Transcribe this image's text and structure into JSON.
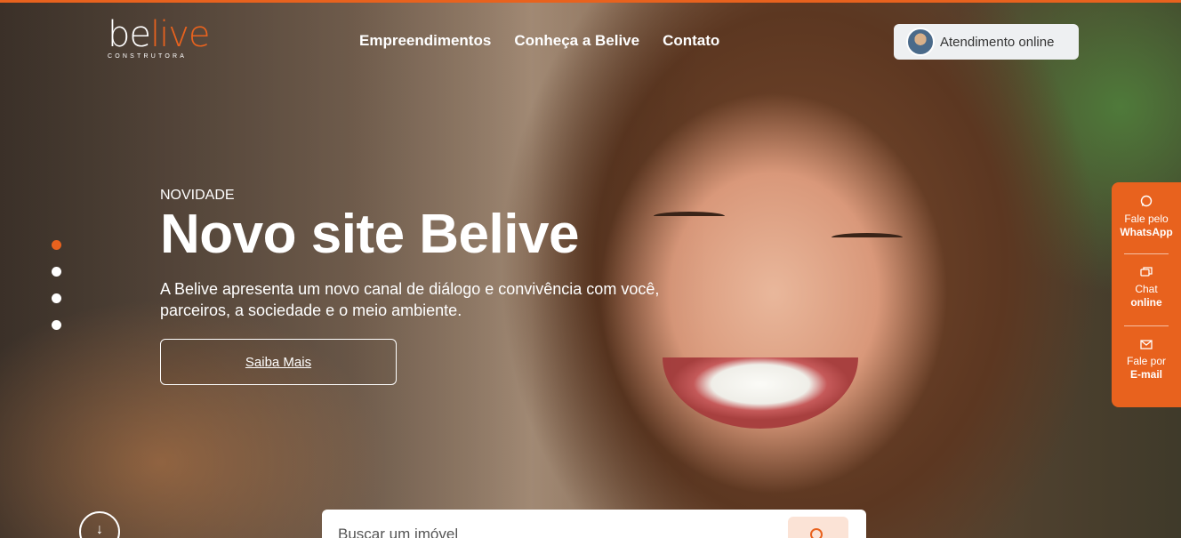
{
  "logo": {
    "be": "be",
    "live": "live",
    "sub": "CONSTRUTORA"
  },
  "nav": {
    "items": [
      "Empreendimentos",
      "Conheça a Belive",
      "Contato"
    ],
    "attend_label": "Atendimento online"
  },
  "hero": {
    "kicker": "NOVIDADE",
    "title": "Novo site Belive",
    "description": "A Belive apresenta um novo canal de diálogo e convivência com você, parceiros, a sociedade e o meio ambiente.",
    "cta": "Saiba Mais",
    "slides": {
      "count": 4,
      "active": 0
    }
  },
  "side": {
    "whatsapp": {
      "icon": "whatsapp-icon",
      "line1": "Fale pelo",
      "line2": "WhatsApp"
    },
    "chat": {
      "icon": "chat-icon",
      "line1": "Chat",
      "line2": "online"
    },
    "email": {
      "icon": "mail-icon",
      "line1": "Fale por",
      "line2": "E-mail"
    }
  },
  "search": {
    "placeholder": "Buscar um imóvel"
  },
  "colors": {
    "accent": "#e8621e",
    "attend_bg": "#eef0f2"
  }
}
